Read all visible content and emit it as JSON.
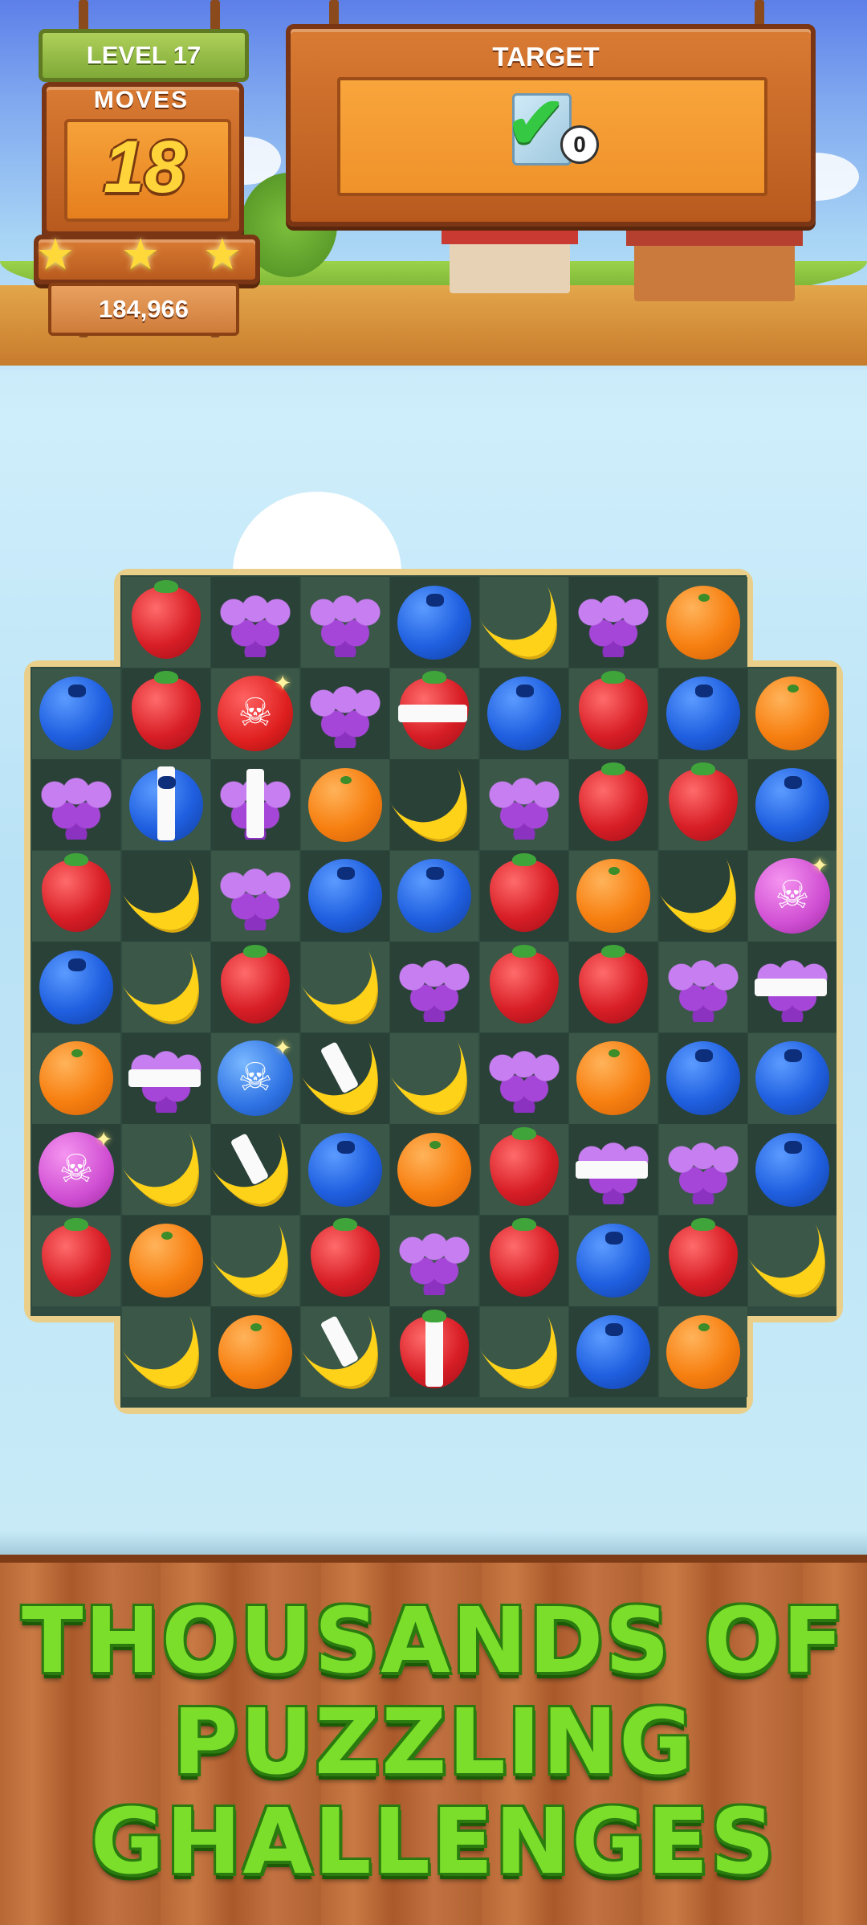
{
  "hud": {
    "level": "LEVEL 17",
    "moves_label": "MOVES",
    "moves": "18",
    "stars_earned": 3,
    "score": "184,966",
    "target_label": "TARGET",
    "target_count": "0",
    "target_icon": "check-icon"
  },
  "board": {
    "rows": [
      [
        "empty",
        "strawberry",
        "grapes",
        "grapes",
        "blueberry",
        "banana",
        "grapes",
        "orange",
        "empty"
      ],
      [
        "blueberry",
        "strawberry",
        "bomb-red",
        "grapes",
        "strawberry-striped-h",
        "blueberry",
        "strawberry",
        "blueberry",
        "orange"
      ],
      [
        "grapes",
        "blueberry-striped-v",
        "grapes-striped-v",
        "orange",
        "banana",
        "grapes",
        "strawberry",
        "strawberry",
        "blueberry"
      ],
      [
        "strawberry",
        "banana",
        "grapes",
        "blueberry",
        "blueberry",
        "strawberry",
        "orange",
        "banana",
        "bomb-purple"
      ],
      [
        "blueberry",
        "banana",
        "strawberry",
        "banana",
        "grapes",
        "strawberry",
        "strawberry",
        "grapes",
        "grapes-striped-h"
      ],
      [
        "orange",
        "grapes-striped-h",
        "bomb-blue",
        "banana-striped-v",
        "banana",
        "grapes",
        "orange",
        "blueberry",
        "blueberry"
      ],
      [
        "bomb-purple",
        "banana",
        "banana-striped-v",
        "blueberry",
        "orange",
        "strawberry",
        "grapes-striped-h",
        "grapes",
        "blueberry"
      ],
      [
        "strawberry",
        "orange",
        "banana",
        "strawberry",
        "grapes",
        "strawberry",
        "blueberry",
        "strawberry",
        "banana"
      ],
      [
        "empty",
        "banana",
        "orange",
        "banana-striped-v",
        "strawberry-striped-v",
        "banana",
        "blueberry",
        "orange",
        "empty"
      ]
    ]
  },
  "promo": {
    "line1": "THOUSANDS OF",
    "line2": "PUZZLING",
    "line3": "GHALLENGES"
  },
  "colors": {
    "promo_text": "#7bde2a",
    "promo_outline": "#2a7a10",
    "board_dark": "#2a4138",
    "board_light": "#3a5748"
  }
}
